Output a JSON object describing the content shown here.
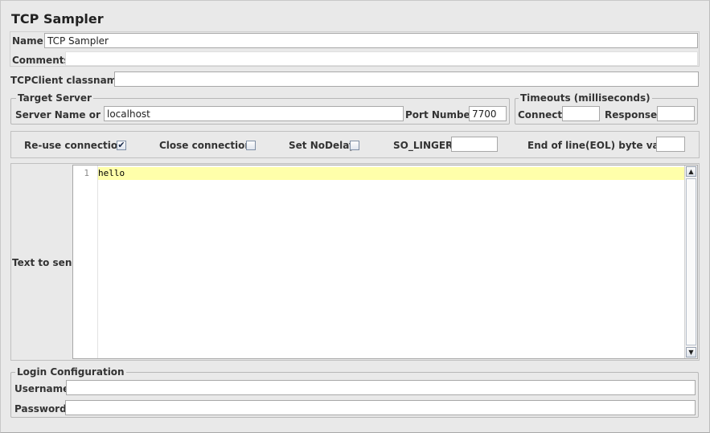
{
  "header": {
    "title": "TCP Sampler"
  },
  "general": {
    "name_label": "Name:",
    "name_value": "TCP Sampler",
    "comments_label": "Comments:",
    "comments_value": ""
  },
  "classname": {
    "label": "TCPClient classname:",
    "value": ""
  },
  "target_server": {
    "legend": "Target Server",
    "server_label": "Server Name or IP:",
    "server_value": "localhost",
    "port_label": "Port Number:",
    "port_value": "7700"
  },
  "timeouts": {
    "legend": "Timeouts (milliseconds)",
    "connect_label": "Connect:",
    "connect_value": "",
    "response_label": "Response:",
    "response_value": ""
  },
  "options": {
    "reuse_label": "Re-use connection",
    "reuse_checked": true,
    "reuse_mark": "✔",
    "close_label": "Close connection",
    "close_checked": false,
    "nodelay_label": "Set NoDelay",
    "nodelay_checked": false,
    "solinger_label": "SO_LINGER:",
    "solinger_value": "",
    "eol_label": "End of line(EOL) byte value:",
    "eol_value": ""
  },
  "text_to_send": {
    "label": "Text to send",
    "line_number": "1",
    "content": "hello",
    "scroll_up_glyph": "▲",
    "scroll_down_glyph": "▼"
  },
  "login": {
    "legend": "Login Configuration",
    "username_label": "Username",
    "username_value": "",
    "password_label": "Password",
    "password_value": ""
  },
  "colors": {
    "background": "#e9e9e9",
    "current_line_highlight": "#ffffaa",
    "input_background": "#ffffff"
  },
  "icons": {
    "checkbox_checked": "check-icon",
    "scroll_up": "arrow-up-icon",
    "scroll_down": "arrow-down-icon"
  }
}
